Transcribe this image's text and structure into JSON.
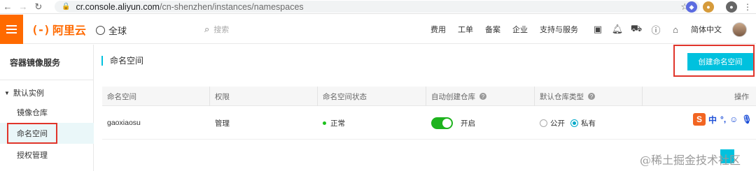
{
  "browser": {
    "url_host": "cr.console.aliyun.com",
    "url_path": "/cn-shenzhen/instances/namespaces"
  },
  "topbar": {
    "logo_mark": "(-)",
    "logo_name": "阿里云",
    "region": "全球",
    "search_placeholder": "搜索",
    "nav": [
      "费用",
      "工单",
      "备案",
      "企业",
      "支持与服务"
    ],
    "language": "简体中文"
  },
  "sidebar": {
    "title": "容器镜像服务",
    "group": "默认实例",
    "items": [
      "镜像仓库",
      "命名空间",
      "授权管理"
    ]
  },
  "main": {
    "page_title": "命名空间",
    "create_button": "创建命名空间",
    "columns": [
      "命名空间",
      "权限",
      "命名空间状态",
      "自动创建仓库",
      "默认仓库类型",
      "操作"
    ],
    "rows": [
      {
        "name": "gaoxiaosu",
        "permission": "管理",
        "status": "正常",
        "auto_create": "开启",
        "repo_type_public": "公开",
        "repo_type_private": "私有"
      }
    ]
  },
  "ime": {
    "logo": "S",
    "label": "中"
  },
  "watermark": "@稀土掘金技术社区",
  "colors": {
    "brand": "#ff6a00",
    "accent": "#00c1de",
    "highlight": "#e0352b",
    "toggle_on": "#1db31d"
  }
}
